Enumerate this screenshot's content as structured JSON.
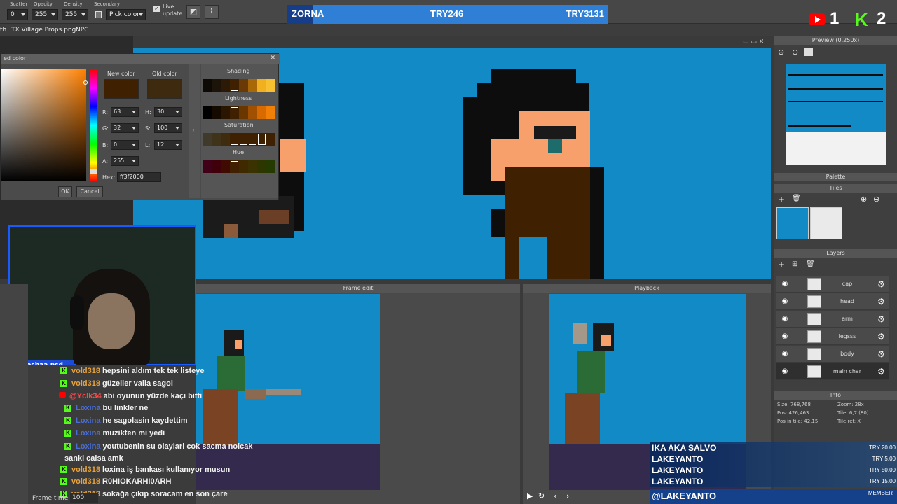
{
  "toolbar": {
    "scatter_label": "Scatter",
    "scatter_value": "0",
    "opacity_label": "Opacity",
    "opacity_value": "255",
    "density_label": "Density",
    "density_value": "255",
    "secondary_label": "Secondary",
    "pick_color": "Pick color",
    "live_update": "Live update"
  },
  "tabs": [
    "th",
    "TX Village Props.png",
    "NPC"
  ],
  "score": {
    "left": "ZORNA",
    "mid": "TRY246",
    "right": "TRY3131"
  },
  "platforms": {
    "youtube_count": "1",
    "kick_count": "2"
  },
  "color_dialog": {
    "title": "ed color",
    "new_color_label": "New color",
    "old_color_label": "Old color",
    "new_color": "#3f2000",
    "old_color": "#3e2a0e",
    "r_label": "R:",
    "r": "63",
    "g_label": "G:",
    "g": "32",
    "b_label": "B:",
    "b": "0",
    "a_label": "A:",
    "a": "255",
    "h_label": "H:",
    "h": "30",
    "s_label": "S:",
    "s": "100",
    "l_label": "L:",
    "l": "12",
    "hex_label": "Hex:",
    "hex": "ff3f2000",
    "shading_label": "Shading",
    "lightness_label": "Lightness",
    "saturation_label": "Saturation",
    "hue_label": "Hue",
    "ok": "OK",
    "cancel": "Cancel"
  },
  "webcam": {
    "handle": "tosbaa.psd"
  },
  "panels": {
    "frame_edit": "Frame edit",
    "playback": "Playback",
    "frame_time_label": "Frame time",
    "frame_time_value": "100"
  },
  "right_panel": {
    "preview_title": "Preview (0.250x)",
    "palette_title": "Palette",
    "tiles_title": "Tiles",
    "layers_title": "Layers",
    "info_title": "Info",
    "layers": [
      {
        "name": "cap",
        "selected": false
      },
      {
        "name": "head",
        "selected": false
      },
      {
        "name": "arm",
        "selected": false
      },
      {
        "name": "legsss",
        "selected": false
      },
      {
        "name": "body",
        "selected": false
      },
      {
        "name": "main char",
        "selected": true
      }
    ],
    "info": {
      "size": "Size: 768,768",
      "zoom": "Zoom: 28x",
      "pos": "Pos: 426,463",
      "tile": "Tile: 6,7 (80)",
      "pos_in_tile": "Pos in tile: 42,15",
      "tile_ref": "Tile ref: X"
    }
  },
  "chat": [
    {
      "user": "vold318",
      "text": "hepsini aldım tek tek listeye",
      "platform": "kick",
      "style": "orange"
    },
    {
      "user": "vold318",
      "text": "güzeller valla sagol",
      "platform": "kick",
      "style": "orange"
    },
    {
      "user": "@Yclk34",
      "text": "abi oyunun yüzde kaçı bitti",
      "platform": "youtube",
      "style": "red"
    },
    {
      "user": "Loxina",
      "text": "bu linkler ne",
      "platform": "kick",
      "style": "blue"
    },
    {
      "user": "Loxina",
      "text": "he sagolasin kaydettim",
      "platform": "kick",
      "style": "blue"
    },
    {
      "user": "Loxina",
      "text": "muzikten mi yedi",
      "platform": "kick",
      "style": "blue"
    },
    {
      "user": "Loxina",
      "text": "youtubenin su olaylari cok sacma nolcak sanki calsa amk",
      "platform": "kick",
      "style": "blue"
    },
    {
      "user": "vold318",
      "text": "loxina iş bankası kullanıyor musun",
      "platform": "kick",
      "style": "orange"
    },
    {
      "user": "vold318",
      "text": "R0HIOKARHI0ARH",
      "platform": "kick",
      "style": "orange"
    },
    {
      "user": "vold318",
      "text": "sokağa çıkıp soracam en son çare",
      "platform": "kick",
      "style": "orange"
    }
  ],
  "donations": [
    {
      "name": "IKA AKA SALVO",
      "amount": "TRY 20.00"
    },
    {
      "name": "LAKEYANTO",
      "amount": "TRY 5.00"
    },
    {
      "name": "LAKEYANTO",
      "amount": "TRY 50.00"
    },
    {
      "name": "LAKEYANTO",
      "amount": "TRY 15.00"
    }
  ],
  "member": {
    "name": "@LAKEYANTO",
    "label": "MEMBER"
  },
  "colors": {
    "canvas_bg": "#128ac5",
    "score_bar": "#2f7fd6",
    "kick_green": "#53fc18",
    "youtube_red": "#ff0000"
  }
}
